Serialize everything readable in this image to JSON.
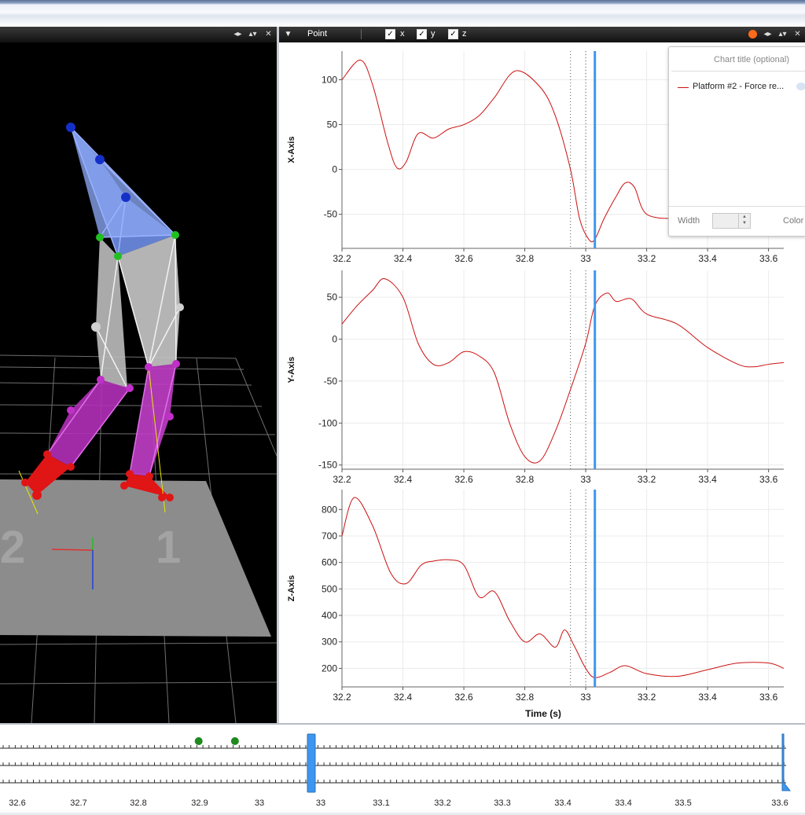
{
  "left_panel": {
    "controls": [
      "◂▸",
      "▴▾",
      "✕"
    ]
  },
  "grid_label_left": "2",
  "grid_label_right": "1",
  "chart_toolbar": {
    "dropdown_arrow": "▼",
    "mode": "Point",
    "checks": [
      {
        "label": "x",
        "checked": true
      },
      {
        "label": "y",
        "checked": true
      },
      {
        "label": "z",
        "checked": true
      }
    ],
    "controls": [
      "◂▸",
      "▴▾",
      "✕"
    ],
    "accent_color": "#ff6a1a"
  },
  "legend_popover": {
    "title_placeholder": "Chart title (optional)",
    "series_label": "Platform #2 - Force re...",
    "width_label": "Width",
    "color_label": "Color"
  },
  "chart_data": [
    {
      "type": "line",
      "ylabel": "X-Axis",
      "xlim": [
        32.2,
        33.65
      ],
      "ylim": [
        -88,
        132
      ],
      "x_ticks": [
        "32.2",
        "32.4",
        "32.6",
        "32.8",
        "33",
        "33.2",
        "33.4",
        "33.6"
      ],
      "y_ticks": [
        100,
        50,
        0,
        -50
      ],
      "series": [
        {
          "color": "#cc1111",
          "x": [
            32.2,
            32.26,
            32.3,
            32.35,
            32.38,
            32.41,
            32.45,
            32.5,
            32.55,
            32.6,
            32.65,
            32.7,
            32.77,
            32.85,
            32.9,
            32.95,
            32.98,
            33.01,
            33.03,
            33.06,
            33.1,
            33.13,
            33.16,
            33.2,
            33.3
          ],
          "y": [
            100,
            122,
            95,
            30,
            2,
            8,
            40,
            35,
            45,
            50,
            60,
            80,
            110,
            92,
            60,
            0,
            -55,
            -78,
            -78,
            -55,
            -30,
            -15,
            -20,
            -50,
            -55
          ]
        }
      ]
    },
    {
      "type": "line",
      "ylabel": "Y-Axis",
      "xlim": [
        32.2,
        33.65
      ],
      "ylim": [
        -155,
        82
      ],
      "x_ticks": [
        "32.2",
        "32.4",
        "32.6",
        "32.8",
        "33",
        "33.2",
        "33.4",
        "33.6"
      ],
      "y_ticks": [
        50,
        0,
        -50,
        -100,
        -150
      ],
      "series": [
        {
          "color": "#cc1111",
          "x": [
            32.2,
            32.25,
            32.3,
            32.34,
            32.4,
            32.45,
            32.5,
            32.55,
            32.6,
            32.65,
            32.7,
            32.75,
            32.8,
            32.85,
            32.9,
            32.95,
            33,
            33.03,
            33.07,
            33.1,
            33.15,
            33.2,
            33.3,
            33.4,
            33.5,
            33.55,
            33.6,
            33.65
          ],
          "y": [
            18,
            40,
            58,
            72,
            50,
            -5,
            -30,
            -28,
            -15,
            -20,
            -40,
            -100,
            -140,
            -145,
            -110,
            -60,
            -5,
            40,
            55,
            45,
            48,
            30,
            18,
            -10,
            -30,
            -33,
            -30,
            -28
          ]
        }
      ]
    },
    {
      "type": "line",
      "ylabel": "Z-Axis",
      "xlabel": "Time (s)",
      "xlim": [
        32.2,
        33.65
      ],
      "ylim": [
        130,
        875
      ],
      "x_ticks": [
        "32.2",
        "32.4",
        "32.6",
        "32.8",
        "33",
        "33.2",
        "33.4",
        "33.6"
      ],
      "y_ticks": [
        800,
        700,
        600,
        500,
        400,
        300,
        200
      ],
      "series": [
        {
          "color": "#cc1111",
          "x": [
            32.2,
            32.24,
            32.3,
            32.36,
            32.41,
            32.46,
            32.5,
            32.55,
            32.6,
            32.65,
            32.7,
            32.75,
            32.8,
            32.85,
            32.9,
            32.93,
            32.96,
            33,
            33.03,
            33.08,
            33.13,
            33.2,
            33.3,
            33.4,
            33.5,
            33.6,
            33.65
          ],
          "y": [
            700,
            845,
            740,
            560,
            520,
            590,
            605,
            610,
            590,
            470,
            490,
            380,
            300,
            330,
            280,
            345,
            290,
            200,
            165,
            185,
            210,
            180,
            170,
            195,
            220,
            220,
            200
          ]
        }
      ]
    }
  ],
  "cursor": {
    "time": 33.03,
    "color": "#3d97ef"
  },
  "dotted_markers": [
    32.95,
    33
  ],
  "timeline": {
    "labels": [
      "32.6",
      "32.7",
      "32.8",
      "32.9",
      "33",
      "33",
      "33.1",
      "33.2",
      "33.3",
      "33.4",
      "33.4",
      "33.5",
      "33.6"
    ],
    "event_markers": [
      32.9,
      32.96
    ]
  }
}
